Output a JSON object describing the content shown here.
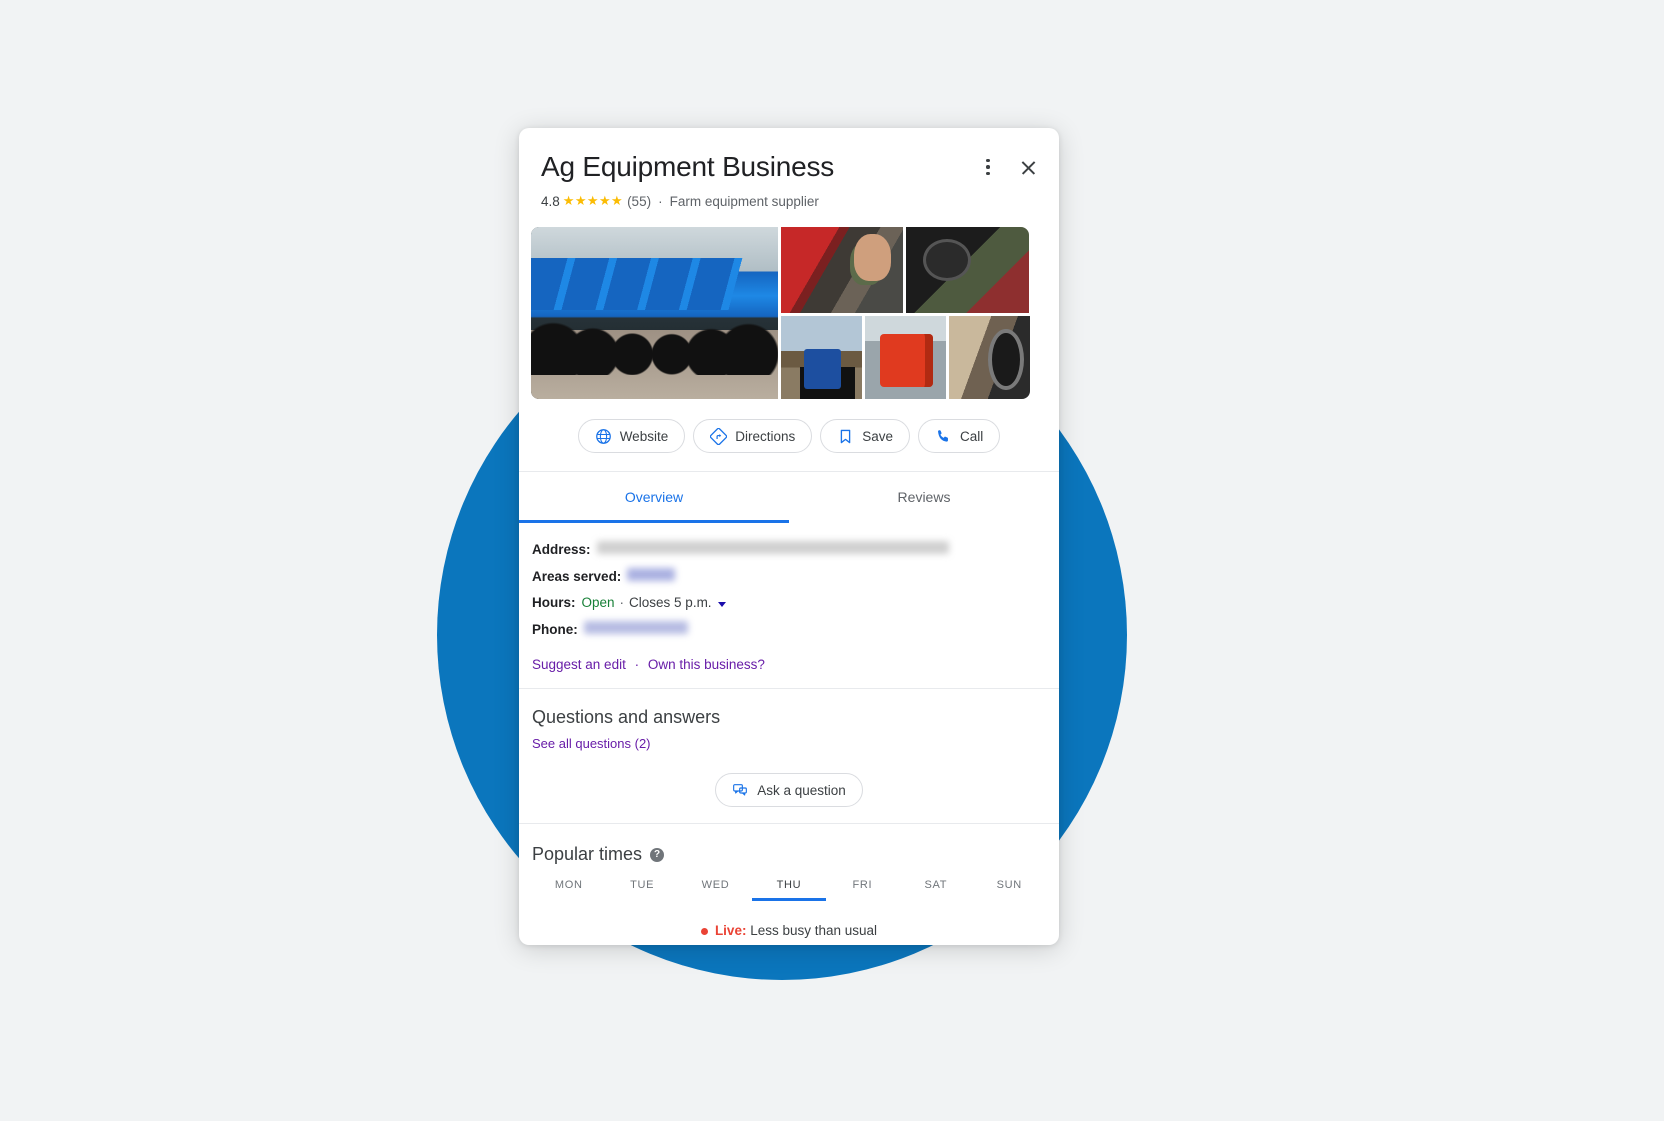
{
  "theme": {
    "page_bg": "#f1f3f4",
    "circle_color": "#0b76bd",
    "accent_blue": "#1a73e8",
    "link_purple": "#681da8",
    "open_green": "#188038",
    "live_red": "#ea4335",
    "star_yellow": "#fbbc04"
  },
  "header": {
    "title": "Ag Equipment Business",
    "rating": "4.8",
    "stars": "★★★★★",
    "review_count": "(55)",
    "separator": "·",
    "category": "Farm equipment supplier",
    "more_options_label": "More options",
    "close_label": "Close"
  },
  "photos": {
    "items": [
      {
        "name": "photo-tractor-lineup",
        "alt": "Row of blue tractors parked in a line"
      },
      {
        "name": "photo-mechanic-red-machine",
        "alt": "Mechanic working on red farm machinery"
      },
      {
        "name": "photo-mechanic-engine",
        "alt": "Technician inspecting engine compartment"
      },
      {
        "name": "photo-blue-compact-tractor",
        "alt": "Blue compact tractor in a field"
      },
      {
        "name": "photo-red-tractor",
        "alt": "Red tractor front view"
      },
      {
        "name": "photo-tractor-wheel",
        "alt": "Close-up of tractor wheel"
      }
    ]
  },
  "actions": [
    {
      "id": "website",
      "label": "Website",
      "icon": "globe-icon"
    },
    {
      "id": "directions",
      "label": "Directions",
      "icon": "directions-icon"
    },
    {
      "id": "save",
      "label": "Save",
      "icon": "bookmark-icon"
    },
    {
      "id": "call",
      "label": "Call",
      "icon": "phone-icon"
    }
  ],
  "tabs": [
    {
      "id": "overview",
      "label": "Overview",
      "active": true
    },
    {
      "id": "reviews",
      "label": "Reviews",
      "active": false
    }
  ],
  "info": {
    "address_label": "Address:",
    "address_value": "",
    "areas_label": "Areas served:",
    "areas_value": "",
    "hours_label": "Hours:",
    "hours_status": "Open",
    "hours_sep": "·",
    "hours_closes": "Closes 5 p.m.",
    "phone_label": "Phone:",
    "phone_value": "",
    "suggest_edit": "Suggest an edit",
    "links_sep": "·",
    "own_business": "Own this business?"
  },
  "qa": {
    "title": "Questions and answers",
    "see_all": "See all questions (2)",
    "ask_label": "Ask a question",
    "ask_icon": "chat-bubbles-icon"
  },
  "popular_times": {
    "title": "Popular times",
    "help_glyph": "?",
    "days": [
      {
        "id": "mon",
        "label": "MON",
        "active": false
      },
      {
        "id": "tue",
        "label": "TUE",
        "active": false
      },
      {
        "id": "wed",
        "label": "WED",
        "active": false
      },
      {
        "id": "thu",
        "label": "THU",
        "active": true
      },
      {
        "id": "fri",
        "label": "FRI",
        "active": false
      },
      {
        "id": "sat",
        "label": "SAT",
        "active": false
      },
      {
        "id": "sun",
        "label": "SUN",
        "active": false
      }
    ],
    "live_label": "Live:",
    "live_text": "Less busy than usual"
  }
}
